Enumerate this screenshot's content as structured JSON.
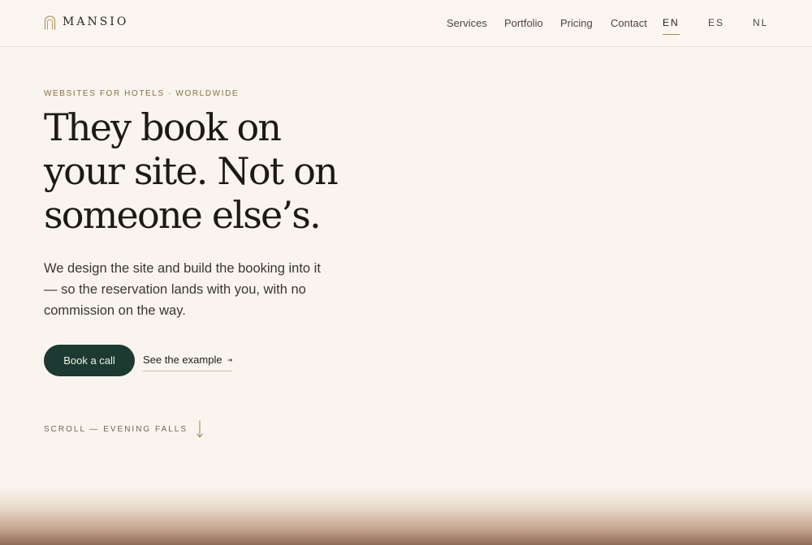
{
  "brand": {
    "name": "MANSIO",
    "icon": "arch-logo-icon"
  },
  "nav": {
    "links": [
      "Services",
      "Portfolio",
      "Pricing",
      "Contact"
    ],
    "languages": [
      "EN",
      "ES",
      "NL"
    ],
    "active_language": "EN"
  },
  "hero": {
    "eyebrow": "WEBSITES FOR HOTELS · WORLDWIDE",
    "headline_lines": [
      "They book on",
      "your site. Not on",
      "someone else’s."
    ],
    "lede": "We design the site and build the booking into it — so the reservation lands with you, with no commission on the way.",
    "primary_cta": "Book a call",
    "secondary_cta": "See the example",
    "secondary_icon": "arrow-right-icon",
    "scroll_cue": "SCROLL — EVENING FALLS",
    "scroll_icon": "arrow-down-icon"
  },
  "colors": {
    "background": "#f9f5ee",
    "header": "#fcf6f0",
    "primary_button": "#1c3a31",
    "accent": "#a08c5b",
    "eyebrow": "#8a6e45"
  }
}
